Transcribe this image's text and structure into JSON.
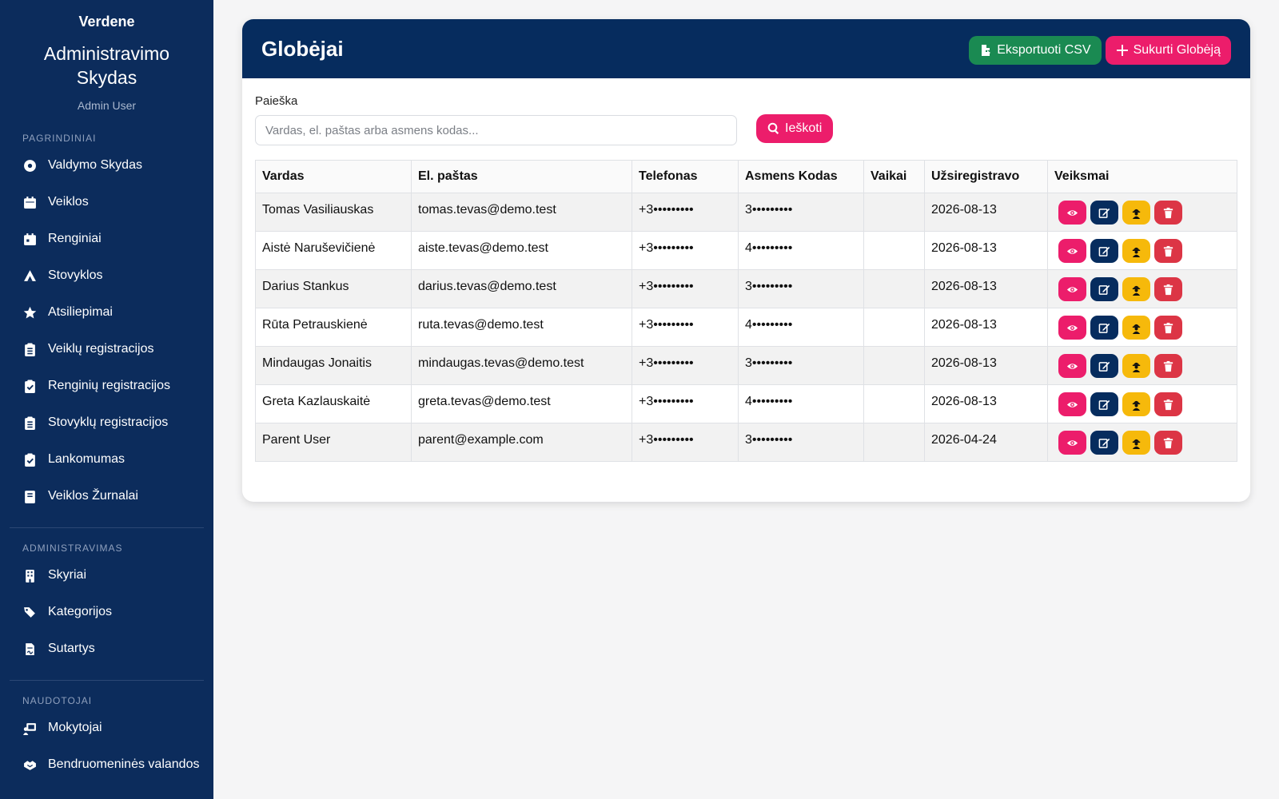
{
  "sidebar": {
    "brand": "Verdene",
    "panel_title": "Administravimo Skydas",
    "user": "Admin User",
    "sections": [
      {
        "label": "PAGRINDINIAI",
        "items": [
          {
            "label": "Valdymo Skydas",
            "icon": "dashboard-icon"
          },
          {
            "label": "Veiklos",
            "icon": "calendar-icon"
          },
          {
            "label": "Renginiai",
            "icon": "calendar-day-icon"
          },
          {
            "label": "Stovyklos",
            "icon": "campground-icon"
          },
          {
            "label": "Atsiliepimai",
            "icon": "star-icon"
          },
          {
            "label": "Veiklų registracijos",
            "icon": "clipboard-list-icon"
          },
          {
            "label": "Renginių registracijos",
            "icon": "clipboard-check-icon"
          },
          {
            "label": "Stovyklų registracijos",
            "icon": "clipboard-list-icon"
          },
          {
            "label": "Lankomumas",
            "icon": "clipboard-check-icon"
          },
          {
            "label": "Veiklos Žurnalai",
            "icon": "book-icon"
          }
        ]
      },
      {
        "label": "ADMINISTRAVIMAS",
        "items": [
          {
            "label": "Skyriai",
            "icon": "building-icon"
          },
          {
            "label": "Kategorijos",
            "icon": "tags-icon"
          },
          {
            "label": "Sutartys",
            "icon": "file-contract-icon"
          }
        ]
      },
      {
        "label": "NAUDOTOJAI",
        "items": [
          {
            "label": "Mokytojai",
            "icon": "chalkboard-teacher-icon"
          },
          {
            "label": "Bendruomeninės valandos",
            "icon": "handshake-icon"
          }
        ]
      }
    ]
  },
  "page": {
    "title": "Globėjai",
    "export_label": "Eksportuoti CSV",
    "create_label": "Sukurti Globėją",
    "search_label": "Paieška",
    "search_placeholder": "Vardas, el. paštas arba asmens kodas...",
    "search_value": "",
    "search_button": "Ieškoti"
  },
  "table": {
    "columns": [
      "Vardas",
      "El. paštas",
      "Telefonas",
      "Asmens Kodas",
      "Vaikai",
      "Užsiregistravo",
      "Veiksmai"
    ],
    "rows": [
      {
        "name": "Tomas Vasiliauskas",
        "email": "tomas.tevas@demo.test",
        "phone": "+3•••••••••",
        "code": "3•••••••••",
        "children": "",
        "registered": "2026-08-13"
      },
      {
        "name": "Aistė Naruševičienė",
        "email": "aiste.tevas@demo.test",
        "phone": "+3•••••••••",
        "code": "4•••••••••",
        "children": "",
        "registered": "2026-08-13"
      },
      {
        "name": "Darius Stankus",
        "email": "darius.tevas@demo.test",
        "phone": "+3•••••••••",
        "code": "3•••••••••",
        "children": "",
        "registered": "2026-08-13"
      },
      {
        "name": "Rūta Petrauskienė",
        "email": "ruta.tevas@demo.test",
        "phone": "+3•••••••••",
        "code": "4•••••••••",
        "children": "",
        "registered": "2026-08-13"
      },
      {
        "name": "Mindaugas Jonaitis",
        "email": "mindaugas.tevas@demo.test",
        "phone": "+3•••••••••",
        "code": "3•••••••••",
        "children": "",
        "registered": "2026-08-13"
      },
      {
        "name": "Greta Kazlauskaitė",
        "email": "greta.tevas@demo.test",
        "phone": "+3•••••••••",
        "code": "4•••••••••",
        "children": "",
        "registered": "2026-08-13"
      },
      {
        "name": "Parent User",
        "email": "parent@example.com",
        "phone": "+3•••••••••",
        "code": "3•••••••••",
        "children": "",
        "registered": "2026-04-24"
      }
    ]
  },
  "colors": {
    "sidebar_bg": "#0c2c5c",
    "header_bg": "#062c5e",
    "accent_pink": "#ec1d6b",
    "green": "#1a8a52",
    "warning": "#f6b90b",
    "danger": "#dc3545"
  }
}
